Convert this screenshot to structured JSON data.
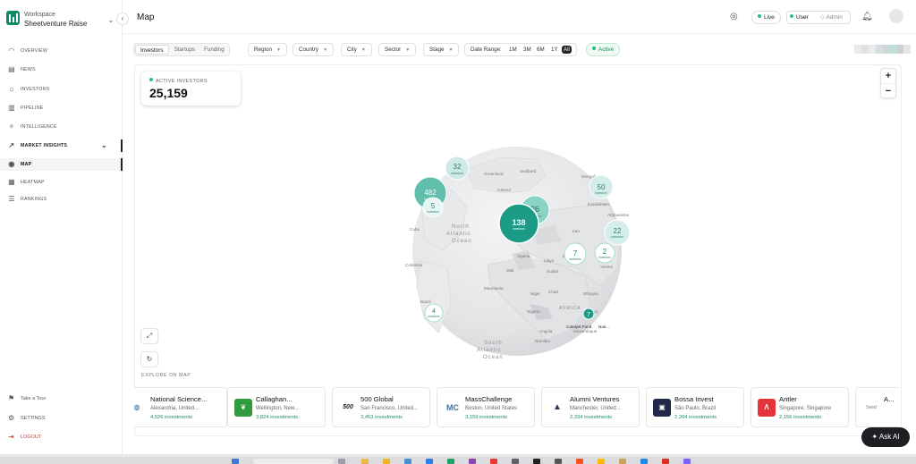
{
  "workspace": {
    "label": "Workspace",
    "name": "Sheetventure Raise"
  },
  "sidebar": {
    "items": [
      {
        "label": "OVERVIEW",
        "icon": "gauge-icon"
      },
      {
        "label": "NEWS",
        "icon": "newspaper-icon"
      },
      {
        "label": "INVESTORS",
        "icon": "bank-icon"
      },
      {
        "label": "PIPELINE",
        "icon": "pipeline-icon"
      },
      {
        "label": "INTELLIGENCE",
        "icon": "sparkle-icon"
      },
      {
        "label": "MARKET INSIGHTS",
        "icon": "trend-icon"
      },
      {
        "label": "MAP",
        "icon": "globe-icon"
      },
      {
        "label": "HEATMAP",
        "icon": "grid-icon"
      },
      {
        "label": "RANKINGS",
        "icon": "list-icon"
      }
    ],
    "bottom": [
      {
        "label": "Take a Tour",
        "icon": "flag-icon"
      },
      {
        "label": "SETTINGS",
        "icon": "gear-icon"
      },
      {
        "label": "LOGOUT",
        "icon": "logout-icon"
      }
    ]
  },
  "header": {
    "title": "Map",
    "live": "Live",
    "user": "User",
    "admin": "Admin"
  },
  "toolbar": {
    "tabs": [
      "Investors",
      "Startups",
      "Funding"
    ],
    "filters": [
      "Region",
      "Country",
      "City",
      "Sector",
      "Stage"
    ],
    "date_label": "Date Range:",
    "ranges": [
      "1M",
      "3M",
      "6M",
      "1Y",
      "All"
    ],
    "active_chip": "Active"
  },
  "stat": {
    "label": "ACTIVE INVESTORS",
    "value": "25,159"
  },
  "globe": {
    "labels": [
      {
        "t": "Greenland"
      },
      {
        "t": "Iceland"
      },
      {
        "t": "Svalbard"
      },
      {
        "t": "Canada"
      },
      {
        "t": "North"
      },
      {
        "t": "Atlantic"
      },
      {
        "t": "Ocean"
      },
      {
        "t": "Cuba"
      },
      {
        "t": "Colombia"
      },
      {
        "t": "Brazil"
      },
      {
        "t": "Mongolia"
      },
      {
        "t": "Kazakhstan"
      },
      {
        "t": "Afghanistan"
      },
      {
        "t": "Iran"
      },
      {
        "t": "Yemen"
      },
      {
        "t": "Algeria"
      },
      {
        "t": "Libya"
      },
      {
        "t": "Egypt"
      },
      {
        "t": "Sudan"
      },
      {
        "t": "Mali"
      },
      {
        "t": "Niger"
      },
      {
        "t": "Chad"
      },
      {
        "t": "Mauritania"
      },
      {
        "t": "Nigeria"
      },
      {
        "t": "Ethiopia"
      },
      {
        "t": "Kenya"
      },
      {
        "t": "Angola"
      },
      {
        "t": "Namibia"
      },
      {
        "t": "South"
      },
      {
        "t": "Atlantic"
      },
      {
        "t": "Ocean"
      },
      {
        "t": "AFRICA"
      },
      {
        "t": "Mozambique"
      }
    ],
    "clusters": [
      {
        "count": "32",
        "sub": "investors"
      },
      {
        "count": "482",
        "sub": "investors"
      },
      {
        "count": "5",
        "sub": "investors"
      },
      {
        "count": "138",
        "sub": "investors"
      },
      {
        "count": "26",
        "sub": "investors"
      },
      {
        "count": "50",
        "sub": "investors"
      },
      {
        "count": "22",
        "sub": "investors"
      },
      {
        "count": "7",
        "sub": "investors"
      },
      {
        "count": "2",
        "sub": "investors"
      },
      {
        "count": "4",
        "sub": "investors"
      }
    ],
    "pin_labels": [
      "Catalyst Fund",
      "Nair..."
    ]
  },
  "explore_label": "EXPLORE ON MAP",
  "cards": [
    {
      "name": "National Science...",
      "loc": "Alexandria, United...",
      "inv": "4,526 investments",
      "logo": "",
      "color": "#1e5fa8"
    },
    {
      "name": "Callaghan...",
      "loc": "Wellington, New...",
      "inv": "3,824 investments",
      "logo": "",
      "color": "#2f9b3c"
    },
    {
      "name": "500 Global",
      "loc": "San Francisco, United...",
      "inv": "3,453 investments",
      "logo": "500",
      "color": "#222222"
    },
    {
      "name": "MassChallenge",
      "loc": "Boston, United States",
      "inv": "3,159 investments",
      "logo": "MC",
      "color": "#3a6fb0"
    },
    {
      "name": "Alumni Ventures",
      "loc": "Manchester, United...",
      "inv": "2,334 investments",
      "logo": "",
      "color": "#1e3a5c"
    },
    {
      "name": "Bossa Invest",
      "loc": "São Paulo, Brazil",
      "inv": "2,204 investments",
      "logo": "",
      "color": "#1e2a48"
    },
    {
      "name": "Antler",
      "loc": "Singapore, Singapore",
      "inv": "2,156 investments",
      "logo": "",
      "color": "#e3343a"
    },
    {
      "name": "A...",
      "loc": "",
      "inv": "",
      "logo": "Seed",
      "color": "#777777"
    }
  ],
  "ask_ai": "Ask AI",
  "colors": {
    "accent": "#159a86",
    "cluster": "#7fd0bf",
    "active_green": "#2bbf7e"
  }
}
